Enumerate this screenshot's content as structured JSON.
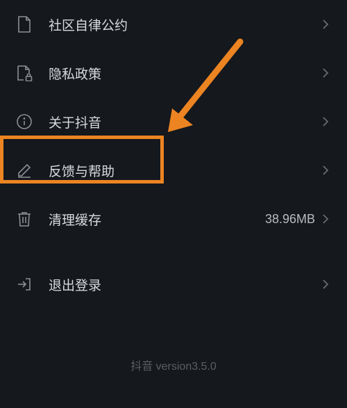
{
  "menu": {
    "items": [
      {
        "key": "community-pact",
        "label": "社区自律公约",
        "icon": "document-icon",
        "value": ""
      },
      {
        "key": "privacy-policy",
        "label": "隐私政策",
        "icon": "lock-document-icon",
        "value": ""
      },
      {
        "key": "about",
        "label": "关于抖音",
        "icon": "info-icon",
        "value": ""
      },
      {
        "key": "feedback-help",
        "label": "反馈与帮助",
        "icon": "edit-icon",
        "value": ""
      },
      {
        "key": "clear-cache",
        "label": "清理缓存",
        "icon": "trash-icon",
        "value": "38.96MB"
      },
      {
        "key": "logout",
        "label": "退出登录",
        "icon": "logout-icon",
        "value": ""
      }
    ]
  },
  "footer": {
    "version_text": "抖音 version3.5.0"
  },
  "annotation": {
    "highlight_color": "#ec8422"
  }
}
